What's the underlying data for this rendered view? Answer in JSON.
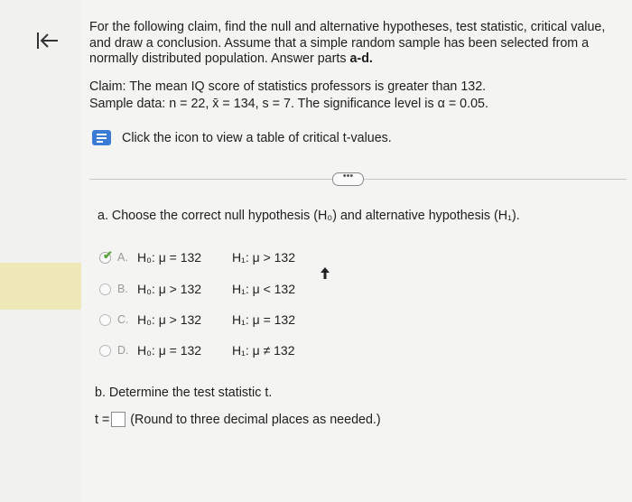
{
  "question": {
    "line1": "For the following claim, find the null and alternative hypotheses, test statistic, critical value,",
    "line2": "and draw a conclusion. Assume that a simple random sample has been selected from a",
    "line3_prefix": "normally distributed population. Answer parts ",
    "line3_bold": "a-d."
  },
  "claim": "Claim: The mean IQ score of statistics professors is greater than 132.",
  "sample_data": "Sample data: n = 22, x̄ = 134, s = 7. The significance level is α = 0.05.",
  "tool_link": "Click the icon to view a table of critical t-values.",
  "more_button": "•••",
  "part_a": "a. Choose the correct null hypothesis (H₀) and alternative hypothesis (H₁).",
  "options": [
    {
      "letter": "A.",
      "h0": "H₀: μ = 132",
      "h1": "H₁: μ > 132",
      "selected": true
    },
    {
      "letter": "B.",
      "h0": "H₀: μ > 132",
      "h1": "H₁: μ < 132",
      "selected": false
    },
    {
      "letter": "C.",
      "h0": "H₀: μ > 132",
      "h1": "H₁: μ = 132",
      "selected": false
    },
    {
      "letter": "D.",
      "h0": "H₀: μ = 132",
      "h1": "H₁: μ ≠ 132",
      "selected": false
    }
  ],
  "part_b": "b. Determine the test statistic t.",
  "answer": {
    "label": "t =",
    "value": "",
    "hint": "(Round to three decimal places as needed.)"
  },
  "colors": {
    "accent": "#3a7bd5",
    "check": "#5aa23a",
    "highlight": "#efe8b8"
  }
}
